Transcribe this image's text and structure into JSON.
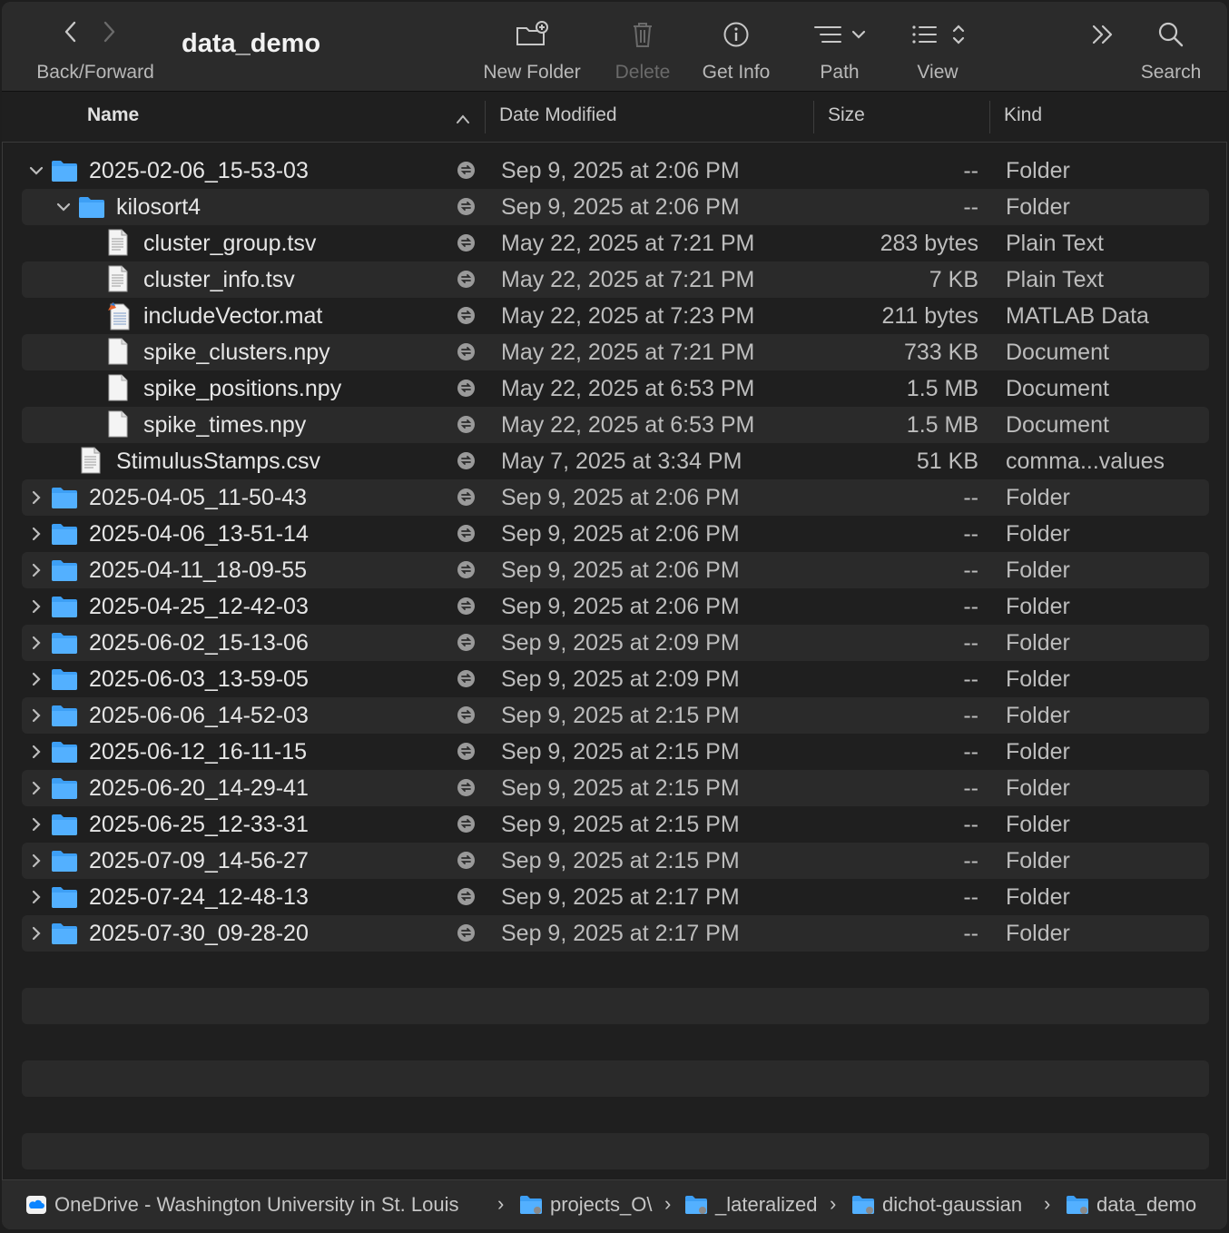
{
  "toolbar": {
    "back_forward_label": "Back/Forward",
    "title": "data_demo",
    "new_folder_label": "New Folder",
    "delete_label": "Delete",
    "get_info_label": "Get Info",
    "path_label": "Path",
    "view_label": "View",
    "search_label": "Search"
  },
  "columns": {
    "name": "Name",
    "date": "Date Modified",
    "size": "Size",
    "kind": "Kind"
  },
  "rows": [
    {
      "name": "2025-02-06_15-53-03",
      "date": "Sep 9, 2025 at 2:06 PM",
      "size": "--",
      "kind": "Folder"
    },
    {
      "name": "kilosort4",
      "date": "Sep 9, 2025 at 2:06 PM",
      "size": "--",
      "kind": "Folder"
    },
    {
      "name": "cluster_group.tsv",
      "date": "May 22, 2025 at 7:21 PM",
      "size": "283 bytes",
      "kind": "Plain Text"
    },
    {
      "name": "cluster_info.tsv",
      "date": "May 22, 2025 at 7:21 PM",
      "size": "7 KB",
      "kind": "Plain Text"
    },
    {
      "name": "includeVector.mat",
      "date": "May 22, 2025 at 7:23 PM",
      "size": "211 bytes",
      "kind": "MATLAB Data"
    },
    {
      "name": "spike_clusters.npy",
      "date": "May 22, 2025 at 7:21 PM",
      "size": "733 KB",
      "kind": "Document"
    },
    {
      "name": "spike_positions.npy",
      "date": "May 22, 2025 at 6:53 PM",
      "size": "1.5 MB",
      "kind": "Document"
    },
    {
      "name": "spike_times.npy",
      "date": "May 22, 2025 at 6:53 PM",
      "size": "1.5 MB",
      "kind": "Document"
    },
    {
      "name": "StimulusStamps.csv",
      "date": "May 7, 2025 at 3:34 PM",
      "size": "51 KB",
      "kind": "comma...values"
    },
    {
      "name": "2025-04-05_11-50-43",
      "date": "Sep 9, 2025 at 2:06 PM",
      "size": "--",
      "kind": "Folder"
    },
    {
      "name": "2025-04-06_13-51-14",
      "date": "Sep 9, 2025 at 2:06 PM",
      "size": "--",
      "kind": "Folder"
    },
    {
      "name": "2025-04-11_18-09-55",
      "date": "Sep 9, 2025 at 2:06 PM",
      "size": "--",
      "kind": "Folder"
    },
    {
      "name": "2025-04-25_12-42-03",
      "date": "Sep 9, 2025 at 2:06 PM",
      "size": "--",
      "kind": "Folder"
    },
    {
      "name": "2025-06-02_15-13-06",
      "date": "Sep 9, 2025 at 2:09 PM",
      "size": "--",
      "kind": "Folder"
    },
    {
      "name": "2025-06-03_13-59-05",
      "date": "Sep 9, 2025 at 2:09 PM",
      "size": "--",
      "kind": "Folder"
    },
    {
      "name": "2025-06-06_14-52-03",
      "date": "Sep 9, 2025 at 2:15 PM",
      "size": "--",
      "kind": "Folder"
    },
    {
      "name": "2025-06-12_16-11-15",
      "date": "Sep 9, 2025 at 2:15 PM",
      "size": "--",
      "kind": "Folder"
    },
    {
      "name": "2025-06-20_14-29-41",
      "date": "Sep 9, 2025 at 2:15 PM",
      "size": "--",
      "kind": "Folder"
    },
    {
      "name": "2025-06-25_12-33-31",
      "date": "Sep 9, 2025 at 2:15 PM",
      "size": "--",
      "kind": "Folder"
    },
    {
      "name": "2025-07-09_14-56-27",
      "date": "Sep 9, 2025 at 2:15 PM",
      "size": "--",
      "kind": "Folder"
    },
    {
      "name": "2025-07-24_12-48-13",
      "date": "Sep 9, 2025 at 2:17 PM",
      "size": "--",
      "kind": "Folder"
    },
    {
      "name": "2025-07-30_09-28-20",
      "date": "Sep 9, 2025 at 2:17 PM",
      "size": "--",
      "kind": "Folder"
    }
  ],
  "pathbar": {
    "items": [
      "OneDrive - Washington University in St. Louis",
      "projects_O\\",
      "_lateralized",
      "dichot-gaussian",
      "data_demo"
    ]
  },
  "colors": {
    "folder": "#3d9ff5",
    "accent": "#0a84ff",
    "background": "#1f1f1f"
  }
}
